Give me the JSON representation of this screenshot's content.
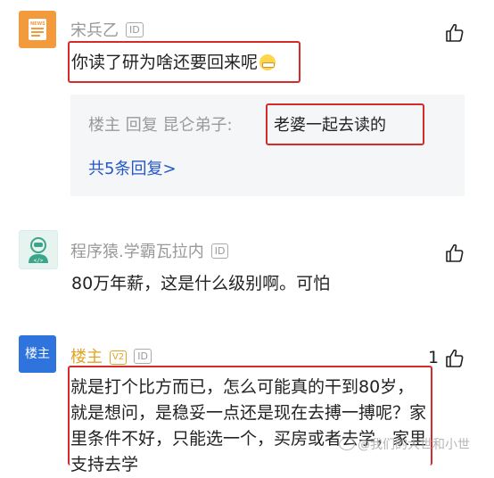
{
  "comments": [
    {
      "username": "宋兵乙",
      "id_badge": "ID",
      "text": "你读了研为啥还要回来呢",
      "like_count": "",
      "reply": {
        "author": "楼主",
        "verb": "回复",
        "target": "昆仑弟子:",
        "text": "老婆一起去读的",
        "more": "共5条回复>"
      }
    },
    {
      "username": "程序猿.学霸瓦拉内",
      "id_badge": "ID",
      "text": "80万年薪，这是什么级别啊。可怕",
      "like_count": ""
    },
    {
      "username": "楼主",
      "avatar_label": "楼主",
      "level_badge": "V2",
      "id_badge": "ID",
      "text": "就是打个比方而已，怎么可能真的干到80岁，就是想问，是稳妥一点还是现在去搏一搏呢？家里条件不好，只能选一个，买房或者去学，家里支持去学",
      "like_count": "1"
    }
  ],
  "watermark": "@我们的大世和小世",
  "colors": {
    "highlight_box": "#d62b2b",
    "link": "#2457c8",
    "host_name": "#e0a526",
    "avatar_host": "#2f74dc"
  },
  "icons": {
    "news_avatar": "news-icon",
    "coder_avatar": "coder-icon",
    "like": "thumbs-up-icon"
  }
}
